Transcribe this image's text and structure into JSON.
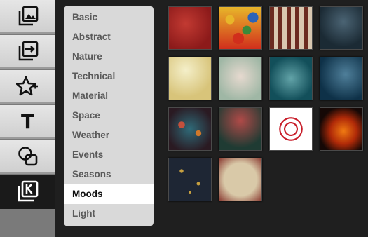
{
  "tools": [
    {
      "name": "images-icon",
      "active": false
    },
    {
      "name": "layer-in-icon",
      "active": false
    },
    {
      "name": "star-sticker-icon",
      "active": false
    },
    {
      "name": "text-icon",
      "label": "T",
      "active": false
    },
    {
      "name": "shapes-icon",
      "active": false
    },
    {
      "name": "backgrounds-icon",
      "active": true
    }
  ],
  "menu": {
    "items": [
      {
        "label": "Basic"
      },
      {
        "label": "Abstract"
      },
      {
        "label": "Nature"
      },
      {
        "label": "Technical"
      },
      {
        "label": "Material"
      },
      {
        "label": "Space"
      },
      {
        "label": "Weather"
      },
      {
        "label": "Events"
      },
      {
        "label": "Seasons"
      },
      {
        "label": "Moods",
        "selected": true
      },
      {
        "label": "Light"
      }
    ]
  },
  "thumbnails": [
    {
      "name": "red-grunge-texture",
      "colors": [
        "#8c1a1a",
        "#c23a32"
      ]
    },
    {
      "name": "candy-balls",
      "colors": [
        "#d12e1c",
        "#e8b62a"
      ]
    },
    {
      "name": "circus-curtain",
      "colors": [
        "#6b2a20",
        "#d9c7b0"
      ]
    },
    {
      "name": "dark-forest",
      "colors": [
        "#1b2a34",
        "#4b6474"
      ]
    },
    {
      "name": "sunburst-bokeh",
      "colors": [
        "#d8c47a",
        "#f4efc9"
      ]
    },
    {
      "name": "floral-bokeh",
      "colors": [
        "#9fb7a5",
        "#e6d9cf"
      ]
    },
    {
      "name": "teal-glow",
      "colors": [
        "#124f5a",
        "#62a3a8"
      ]
    },
    {
      "name": "blue-smoke",
      "colors": [
        "#0e3148",
        "#4f7f9a"
      ]
    },
    {
      "name": "heart-bokeh",
      "colors": [
        "#2a1a22",
        "#c3503c"
      ]
    },
    {
      "name": "heart-tree",
      "colors": [
        "#1f3b33",
        "#b04a48"
      ]
    },
    {
      "name": "heart-swirl",
      "colors": [
        "#ffffff",
        "#c81e2a"
      ]
    },
    {
      "name": "fire-hearts",
      "colors": [
        "#150806",
        "#f07a12"
      ]
    },
    {
      "name": "gold-stars",
      "colors": [
        "#1e2634",
        "#c7a040"
      ]
    },
    {
      "name": "floral-paper",
      "colors": [
        "#d9c9a8",
        "#8c3f35"
      ]
    }
  ]
}
